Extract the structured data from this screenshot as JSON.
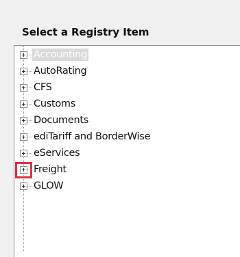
{
  "panel": {
    "title": "Select a Registry Item"
  },
  "tree": {
    "items": [
      {
        "label": "Accounting",
        "selected": true
      },
      {
        "label": "AutoRating"
      },
      {
        "label": "CFS"
      },
      {
        "label": "Customs"
      },
      {
        "label": "Documents"
      },
      {
        "label": "ediTariff and BorderWise"
      },
      {
        "label": "eServices"
      },
      {
        "label": "Freight",
        "highlighted": true
      },
      {
        "label": "GLOW"
      }
    ]
  },
  "colors": {
    "highlight": "#e03040",
    "selection_bg": "#d9d9d9"
  }
}
